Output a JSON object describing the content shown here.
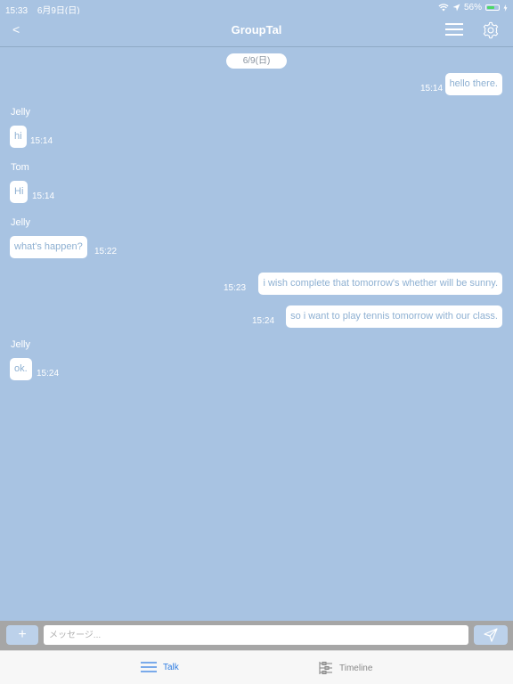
{
  "status_bar": {
    "time": "15:33",
    "date": "6月9日(日)",
    "battery": "56%"
  },
  "nav": {
    "back": "<",
    "title": "GroupTal"
  },
  "date_separator": "6/9(日)",
  "messages": [
    {
      "sender": "",
      "text": "hello there.",
      "time": "15:14",
      "side": "right"
    },
    {
      "sender": "Jelly",
      "text": "hi",
      "time": "15:14",
      "side": "left"
    },
    {
      "sender": "Tom",
      "text": "Hi",
      "time": "15:14",
      "side": "left"
    },
    {
      "sender": "Jelly",
      "text": "what's happen?",
      "time": "15:22",
      "side": "left"
    },
    {
      "sender": "",
      "text": "i wish complete that tomorrow's whether will be sunny.",
      "time": "15:23",
      "side": "right"
    },
    {
      "sender": "",
      "text": "so i want to play tennis tomorrow with our class.",
      "time": "15:24",
      "side": "right"
    },
    {
      "sender": "Jelly",
      "text": "ok.",
      "time": "15:24",
      "side": "left"
    }
  ],
  "input": {
    "plus": "+",
    "placeholder": "メッセージ...",
    "value": ""
  },
  "tabs": [
    {
      "label": "Talk",
      "active": true
    },
    {
      "label": "Timeline",
      "active": false
    }
  ],
  "colors": {
    "background": "#a8c3e2",
    "accent": "#2f7de1",
    "bubble_text": "#8eb0d2"
  }
}
